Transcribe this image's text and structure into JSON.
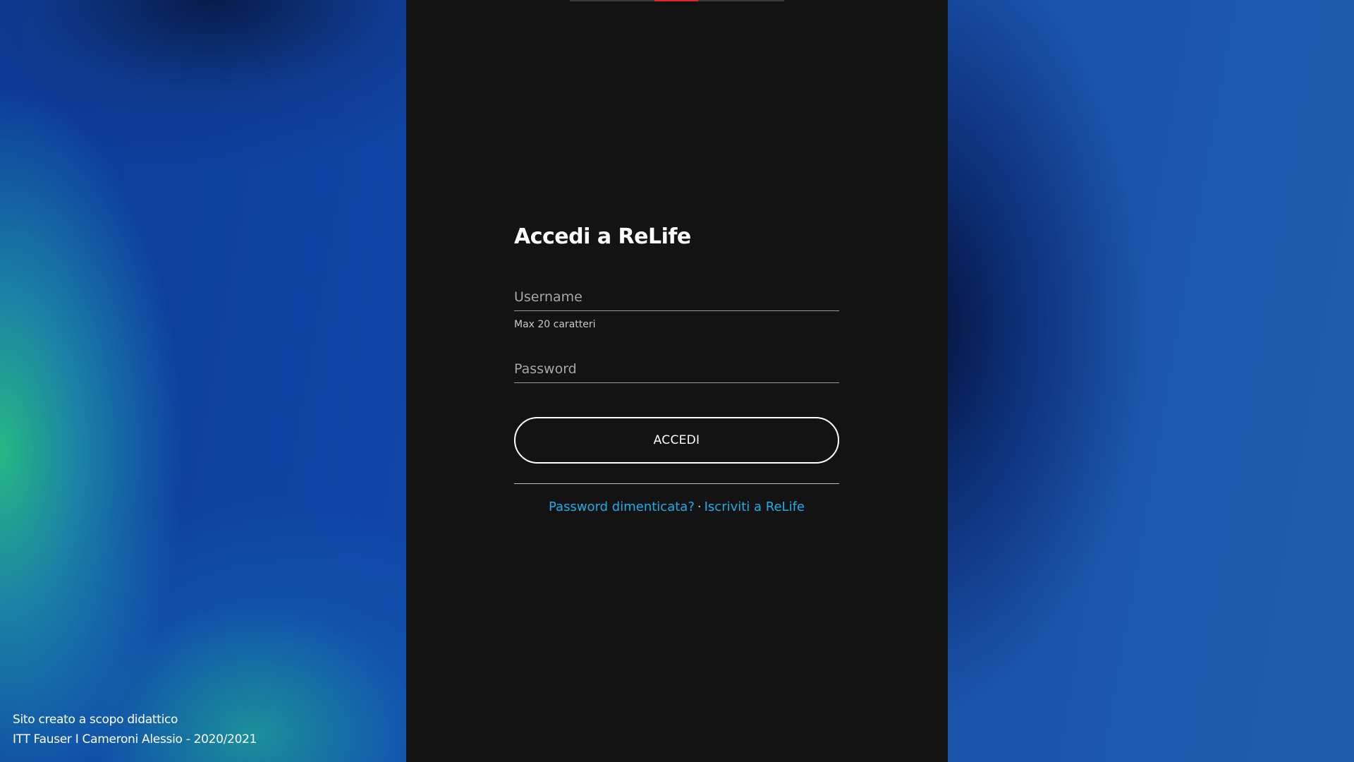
{
  "login": {
    "title": "Accedi a ReLife",
    "username_placeholder": "Username",
    "username_hint": "Max 20 caratteri",
    "password_placeholder": "Password",
    "submit_label": "ACCEDI",
    "forgot_password_link": "Password dimenticata?",
    "separator": "·",
    "signup_link": "Iscriviti a ReLife"
  },
  "footer": {
    "line1": "Sito creato a scopo didattico",
    "line2": "ITT Fauser I Cameroni Alessio - 2020/2021"
  },
  "colors": {
    "panel_background": "#131313",
    "link": "#1eaee8",
    "active_tab": "#e3262b"
  }
}
